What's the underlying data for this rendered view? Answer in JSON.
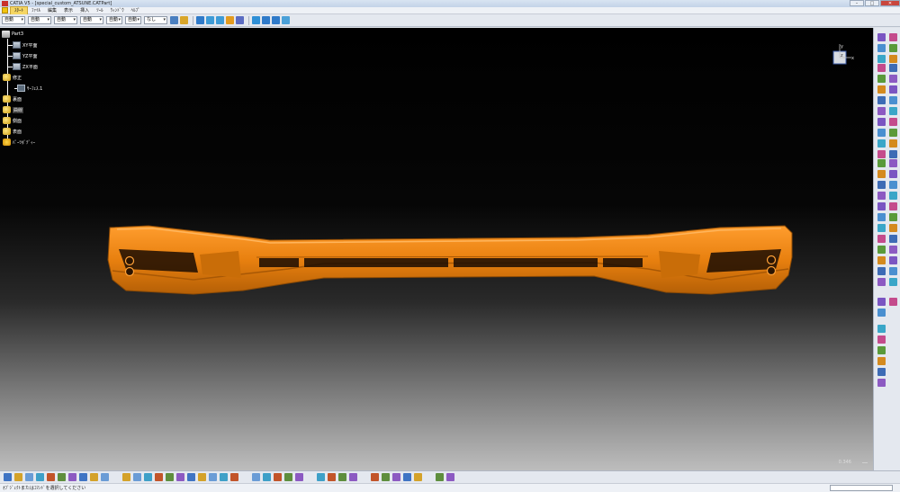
{
  "window": {
    "title": "CATIA V5 - [special_custom_ATSUNE.CATPart]",
    "buttons": {
      "minimize": "–",
      "maximize": "□",
      "close": "✕"
    }
  },
  "menu": {
    "items": [
      "ｽﾀｰﾄ",
      "ﾌｧｲﾙ",
      "編集",
      "表示",
      "挿入",
      "ﾂｰﾙ",
      "ｳｨﾝﾄﾞｳ",
      "ﾍﾙﾌﾟ"
    ]
  },
  "style_toolbar": {
    "dropdowns": [
      "自動",
      "自動",
      "自動",
      "自動",
      "自動",
      "自動",
      "なし"
    ]
  },
  "tree": {
    "root": "Part3",
    "nodes": [
      {
        "label": "XY平面",
        "icon": "plane-icon"
      },
      {
        "label": "YZ平面",
        "icon": "plane-icon"
      },
      {
        "label": "ZX平面",
        "icon": "plane-icon"
      },
      {
        "label": "修正",
        "icon": "geometrical-set-icon"
      },
      {
        "label": "ｻｰﾌｪｽ.1",
        "icon": "surface-icon"
      },
      {
        "label": "裏面",
        "icon": "geometrical-set-icon"
      },
      {
        "label": "曲線",
        "icon": "geometrical-set-icon"
      },
      {
        "label": "側面",
        "icon": "geometrical-set-icon"
      },
      {
        "label": "表面",
        "icon": "geometrical-set-icon"
      },
      {
        "label": "ﾊﾟｰﾂﾎﾞﾃﾞｨｰ",
        "icon": "part-body-icon"
      }
    ]
  },
  "compass": {
    "axis_y": "y",
    "axis_z": "z",
    "axis_x": "x"
  },
  "viewport": {
    "scale_value": "0.346",
    "model_color": "#e8800f",
    "model_dark": "#b45f06",
    "model_light": "#ffa238"
  },
  "status": {
    "message": "ｵﾌﾞｼﾞｪｸﾄまたはｺﾏﾝﾄﾞを選択してください"
  }
}
